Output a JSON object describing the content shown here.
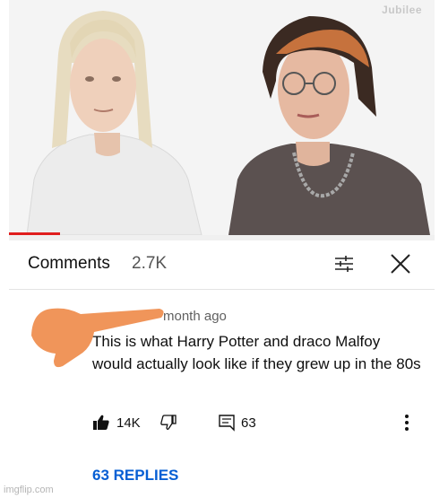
{
  "video": {
    "watermark": "Jubilee",
    "progress_fraction": 0.12
  },
  "comments_header": {
    "title": "Comments",
    "count": "2.7K",
    "icons": [
      "filter-icon",
      "close-icon"
    ]
  },
  "comment": {
    "timestamp": "month ago",
    "text": "This is what Harry Potter and draco Malfoy would actually look like if they grew up in the 80s",
    "likes": "14K",
    "reply_count": "63",
    "replies_link": "63 REPLIES",
    "icons": [
      "thumbs-up-icon",
      "thumbs-down-icon",
      "reply-icon",
      "more-options-icon"
    ]
  },
  "footer": {
    "watermark": "imgflip.com"
  },
  "colors": {
    "link_blue": "#065fd4",
    "redaction_orange": "#f0955a",
    "progress_red": "#e01e1e"
  }
}
